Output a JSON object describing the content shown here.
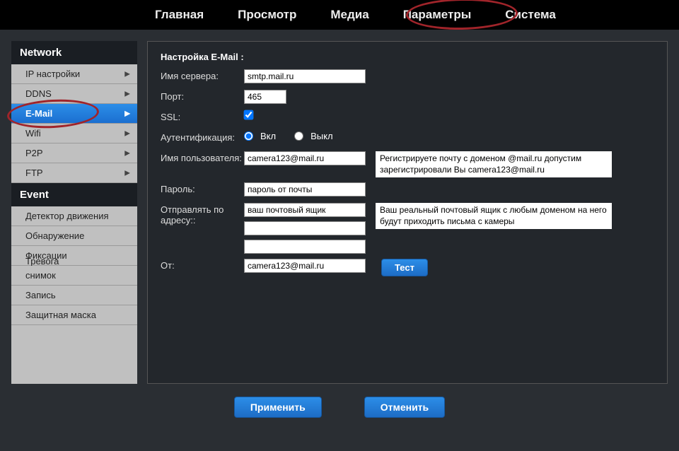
{
  "topnav": {
    "home": "Главная",
    "preview": "Просмотр",
    "media": "Медиа",
    "params": "Параметры",
    "system": "Система"
  },
  "sidebar": {
    "network_head": "Network",
    "event_head": "Event",
    "ip": "IP настройки",
    "ddns": "DDNS",
    "email": "E-Mail",
    "wifi": "Wifi",
    "p2p": "P2P",
    "ftp": "FTP",
    "motion": "Детектор движения",
    "detect": "Обнаружение",
    "fiksatsii": "Фиксации",
    "trevoga": "Тревога",
    "snapshot": "снимок",
    "record": "Запись",
    "mask": "Защитная маска"
  },
  "panel": {
    "title": "Настройка E-Mail :",
    "server_name": "Имя сервера:",
    "server_val": "smtp.mail.ru",
    "port": "Порт:",
    "port_val": "465",
    "ssl": "SSL:",
    "auth": "Аутентификация:",
    "on": "Вкл",
    "off": "Выкл",
    "username": "Имя пользователя:",
    "username_val": "camera123@mail.ru",
    "password": "Пароль:",
    "password_val": "пароль от почты",
    "sendto": "Отправлять по адресу::",
    "sendto_val": "ваш почтовый ящик",
    "from": "От:",
    "from_val": "camera123@mail.ru",
    "hint1": "Регистрируете почту с доменом @mail.ru допустим зарегистрировали Вы camera123@mail.ru",
    "hint2": "Ваш реальный почтовый ящик с любым доменом на него будут приходить письма с камеры",
    "test": "Тест",
    "apply": "Применить",
    "cancel": "Отменить"
  }
}
